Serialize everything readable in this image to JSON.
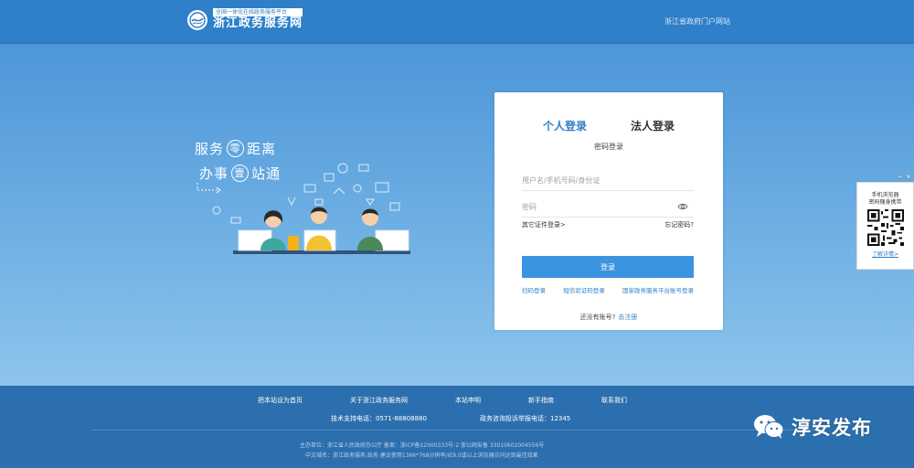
{
  "header": {
    "logo_subtitle": "全国一体化在线政务服务平台",
    "logo_title": "浙江政务服务网",
    "portal_link": "浙江省政府门户网站"
  },
  "hero": {
    "slogan_line1": {
      "before": "服务",
      "circled": "零",
      "after": "距离"
    },
    "slogan_line2": {
      "before": "办事",
      "circled": "壹",
      "after": "站通"
    }
  },
  "login": {
    "tabs": [
      {
        "label": "个人登录",
        "active": true
      },
      {
        "label": "法人登录",
        "active": false
      }
    ],
    "mode_label": "密码登录",
    "username_placeholder": "用户名/手机号码/身份证",
    "password_placeholder": "密码",
    "other_cert_login": "其它证件登录>",
    "forgot_password": "忘记密码?",
    "login_button": "登录",
    "alt_logins": [
      "扫码登录",
      "短信验证码登录",
      "国家政务服务平台账号登录"
    ],
    "no_account_text": "还没有账号?",
    "register_link": "去注册"
  },
  "qr_widget": {
    "title_line1": "手机浏览器",
    "title_line2": "密码随身携带",
    "more_link": "了解详情>"
  },
  "footer": {
    "nav": [
      "把本站设为首页",
      "关于浙江政务服务网",
      "本站申明",
      "新手指南",
      "联系我们"
    ],
    "tech_support": "技术支持电话：0571-88808880",
    "complaint": "政务咨询投诉举报电话：12345",
    "info_line1": "主办单位：浙江省人民政府办公厅   备案：浙ICP备12000333号-2   浙公网安备 33010602004556号",
    "info_line2": "中文域名：浙江政务服务.政务   建议使用1366*768分辨率/IE9.0或以上浏览器访问达到最佳效果"
  },
  "watermark": {
    "text": "淳安发布",
    "icon": "wechat-icon"
  },
  "colors": {
    "header_bg": "#2f7fc9",
    "accent": "#3a94e0",
    "footer_bg": "#2c6fae",
    "card_bg": "#ffffff"
  }
}
